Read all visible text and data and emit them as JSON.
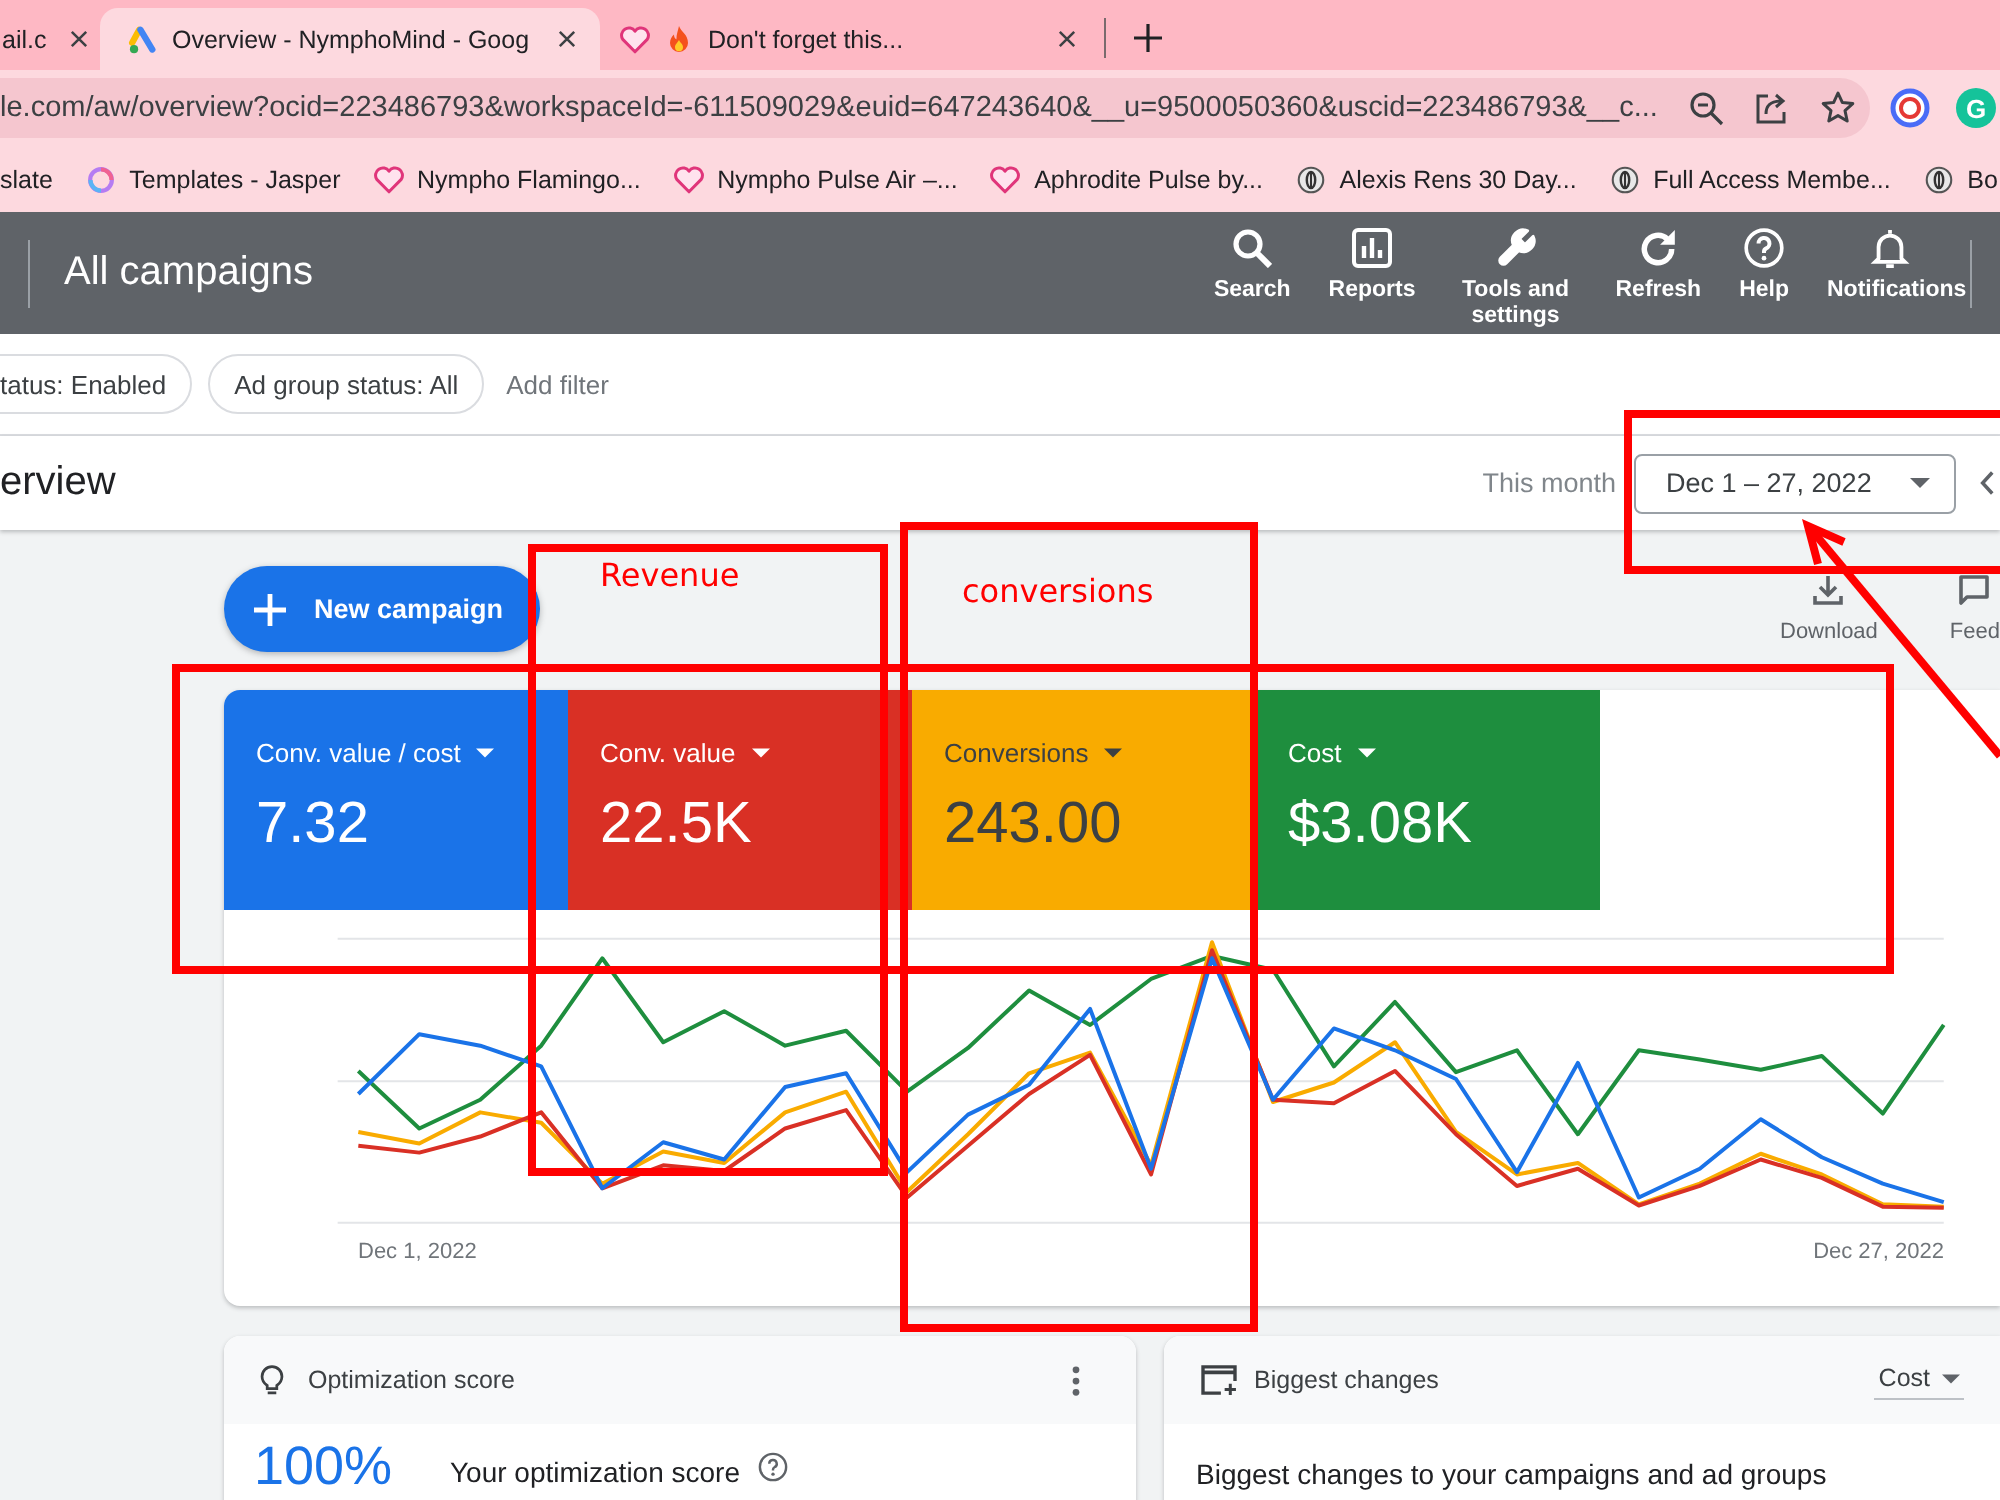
{
  "browser": {
    "tabs": [
      {
        "kind": "plain",
        "title": "ail.c",
        "selected": false
      },
      {
        "kind": "ads",
        "title": "Overview - NymphoMind - Goog",
        "selected": true
      },
      {
        "kind": "promo",
        "title": "Don't forget this...",
        "selected": false
      }
    ],
    "address": {
      "url": "le.com/aw/overview?ocid=223486793&workspaceId=-611509029&euid=647243640&__u=9500050360&uscid=223486793&__c..."
    },
    "extensions": [
      {
        "kind": "ring"
      },
      {
        "kind": "letter",
        "text": "G"
      }
    ],
    "bookmarks": [
      {
        "kind": "plain",
        "title": "slate"
      },
      {
        "kind": "swirl",
        "title": "Templates - Jasper"
      },
      {
        "kind": "heart",
        "title": "Nympho Flamingo..."
      },
      {
        "kind": "heart",
        "title": "Nympho Pulse Air –..."
      },
      {
        "kind": "heart",
        "title": "Aphrodite Pulse by..."
      },
      {
        "kind": "round",
        "title": "Alexis Rens 30 Day..."
      },
      {
        "kind": "round",
        "title": "Full Access Membe..."
      },
      {
        "kind": "round",
        "title": "Bo"
      }
    ]
  },
  "header": {
    "title": "All campaigns",
    "tools": [
      {
        "kind": "search",
        "label": "Search"
      },
      {
        "kind": "reports",
        "label": "Reports"
      },
      {
        "kind": "tools",
        "label": "Tools and settings"
      },
      {
        "kind": "refresh",
        "label": "Refresh"
      },
      {
        "kind": "help",
        "label": "Help"
      },
      {
        "kind": "notifications",
        "label": "Notifications"
      }
    ]
  },
  "filters": {
    "chips": [
      "tatus: Enabled",
      "Ad group status: All"
    ],
    "add_filter": "Add filter"
  },
  "overview": {
    "title": "erview",
    "period": "This month",
    "date_range": "Dec 1 – 27, 2022"
  },
  "actions": {
    "new_campaign": "New campaign",
    "download": "Download",
    "feedback": "Feed"
  },
  "metrics": [
    {
      "label": "Conv. value / cost",
      "value": "7.32",
      "color": "#1a73e8"
    },
    {
      "label": "Conv. value",
      "value": "22.5K",
      "color": "#d93025"
    },
    {
      "label": "Conversions",
      "value": "243.00",
      "color": "#f9ab00"
    },
    {
      "label": "Cost",
      "value": "$3.08K",
      "color": "#1e8e3e"
    }
  ],
  "chart": {
    "x_start": "Dec 1, 2022",
    "x_end": "Dec 27, 2022"
  },
  "optimization": {
    "title": "Optimization score",
    "score": "100%",
    "label": "Your optimization score"
  },
  "changes": {
    "title": "Biggest changes",
    "sort": "Cost",
    "description": "Biggest changes to your campaigns and ad groups"
  },
  "annotations": [
    {
      "kind": "frame"
    },
    {
      "kind": "frame",
      "label": "Revenue"
    },
    {
      "kind": "frame",
      "label": "conversions"
    },
    {
      "kind": "frame"
    },
    {
      "kind": "arrow"
    }
  ]
}
